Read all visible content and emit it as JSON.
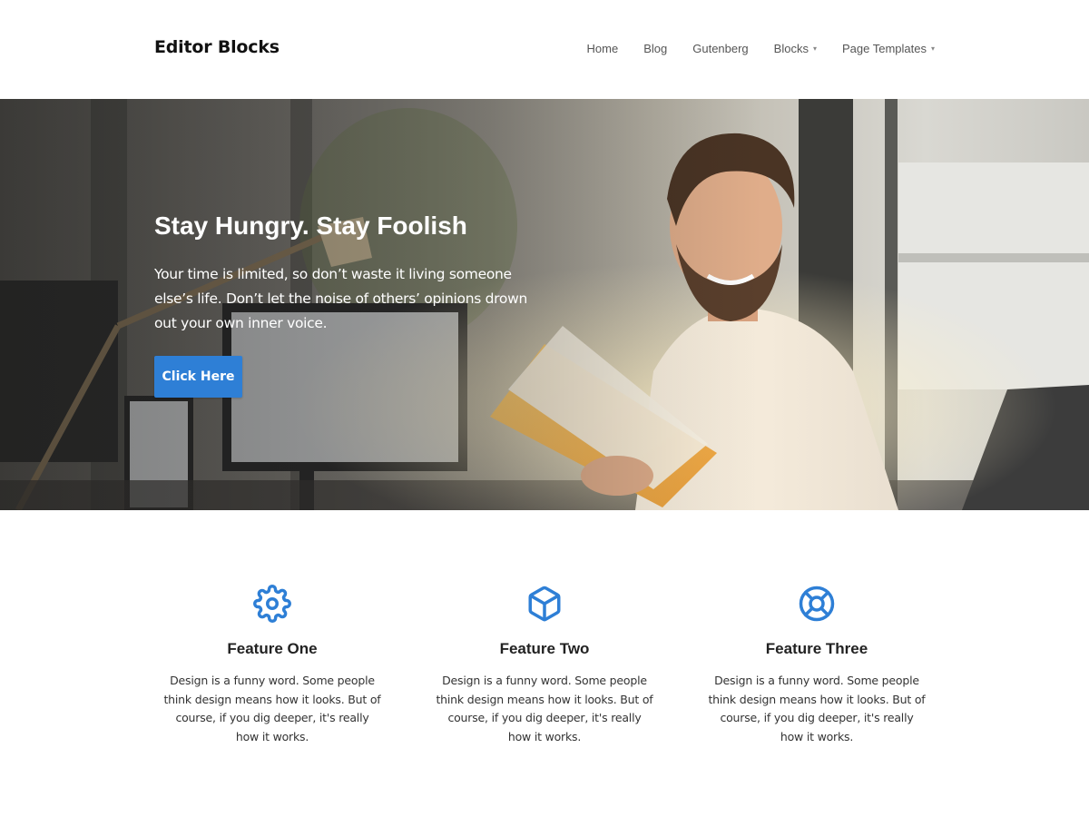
{
  "site": {
    "title": "Editor Blocks"
  },
  "nav": {
    "items": [
      {
        "label": "Home",
        "has_dropdown": false
      },
      {
        "label": "Blog",
        "has_dropdown": false
      },
      {
        "label": "Gutenberg",
        "has_dropdown": false
      },
      {
        "label": "Blocks",
        "has_dropdown": true
      },
      {
        "label": "Page Templates",
        "has_dropdown": true
      }
    ],
    "caret": "▾"
  },
  "hero": {
    "title": "Stay Hungry. Stay Foolish",
    "text": "Your time is limited, so don’t waste it living someone else’s life. Don’t let the noise of others’ opinions drown out your own inner voice.",
    "button_label": "Click Here",
    "image": "man-reading-book-in-office-photo"
  },
  "features": [
    {
      "icon": "gear-icon",
      "title": "Feature One",
      "text": "Design is a funny word. Some people think design means how it looks. But of course, if you dig deeper, it's really how it works."
    },
    {
      "icon": "cube-icon",
      "title": "Feature Two",
      "text": "Design is a funny word. Some people think design means how it looks. But of course, if you dig deeper, it's really how it works."
    },
    {
      "icon": "lifebuoy-icon",
      "title": "Feature Three",
      "text": "Design is a funny word. Some people think design means how it looks. But of course, if you dig deeper, it's really how it works."
    }
  ],
  "colors": {
    "accent": "#2e7fd6",
    "icon": "#2e7fd6",
    "text": "#333333",
    "nav_text": "#555555"
  }
}
